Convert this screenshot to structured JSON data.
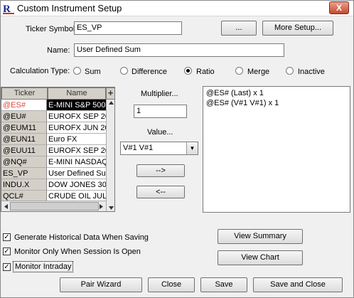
{
  "window": {
    "title": "Custom Instrument Setup",
    "close_glyph": "X"
  },
  "fields": {
    "ticker_label": "Ticker Symbol:",
    "ticker_value": "ES_VP",
    "ellipsis_button": "...",
    "more_setup_button": "More Setup...",
    "name_label": "Name:",
    "name_value": "User Defined Sum"
  },
  "calculation": {
    "label": "Calculation Type:",
    "options": [
      "Sum",
      "Difference",
      "Ratio",
      "Merge",
      "Inactive"
    ],
    "selected": "Ratio"
  },
  "grid": {
    "columns": [
      "Ticker",
      "Name"
    ],
    "add_glyph": "+",
    "rows": [
      {
        "ticker": "@ES#",
        "name": "E-MINI S&P 500",
        "selected": true
      },
      {
        "ticker": "@EU#",
        "name": "EUROFX SEP 20"
      },
      {
        "ticker": "@EUM11",
        "name": "EUROFX JUN 20"
      },
      {
        "ticker": "@EUN11",
        "name": "Euro FX"
      },
      {
        "ticker": "@EUU11",
        "name": "EUROFX SEP 20"
      },
      {
        "ticker": "@NQ#",
        "name": "E-MINI NASDAQ"
      },
      {
        "ticker": "ES_VP",
        "name": "User Defined Su"
      },
      {
        "ticker": "INDU.X",
        "name": "DOW JONES 30"
      },
      {
        "ticker": "QCL#",
        "name": "CRUDE OIL JUL"
      }
    ]
  },
  "middle": {
    "multiplier_label": "Multiplier...",
    "multiplier_value": "1",
    "value_label": "Value...",
    "value_selected": "V#1  V#1",
    "add_arrow": "-->",
    "remove_arrow": "<--"
  },
  "formula_lines": [
    "@ES# (Last) x 1",
    "@ES# (V#1  V#1) x 1"
  ],
  "options": [
    {
      "label": "Generate Historical Data When Saving",
      "checked": true
    },
    {
      "label": "Monitor Only When Session Is Open",
      "checked": true
    },
    {
      "label": "Monitor Intraday",
      "checked": true
    }
  ],
  "buttons": {
    "view_summary": "View Summary",
    "view_chart": "View Chart",
    "pair_wizard": "Pair Wizard",
    "close": "Close",
    "save": "Save",
    "save_and_close": "Save and Close"
  },
  "colors": {
    "selected_row_bg": "#000000",
    "selected_ticker_text": "#e0463a",
    "close_button": "#c74a2c"
  }
}
